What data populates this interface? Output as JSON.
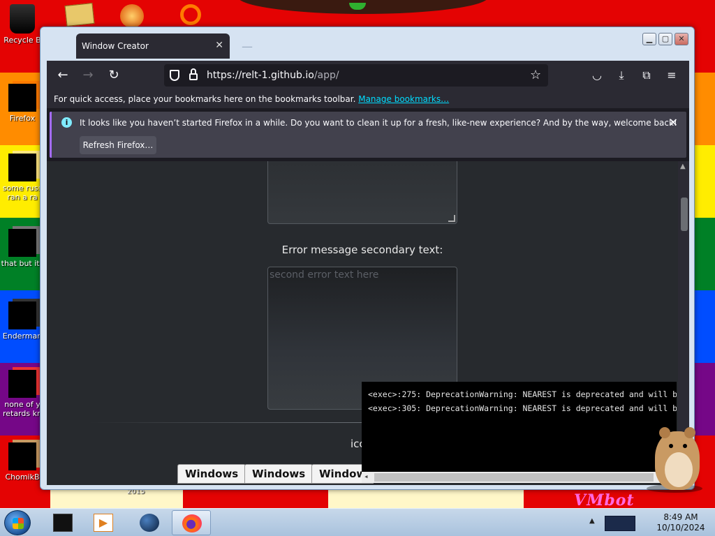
{
  "desktop": {
    "icons": [
      {
        "label": "Recycle B"
      },
      {
        "label": "Firefox"
      },
      {
        "label": "some russ ran a ra"
      },
      {
        "label": "that but its"
      },
      {
        "label": "Enderman"
      },
      {
        "label": "none of y retards kn"
      },
      {
        "label": "ChomikB"
      }
    ],
    "wallpaper_year": "2015",
    "vm_brand": "VMbot"
  },
  "window": {
    "tab_title": "Window Creator",
    "url_main": "https://relt-1.github.io",
    "url_path": "/app/"
  },
  "bookmarks_bar": {
    "text": "For quick access, place your bookmarks here on the bookmarks toolbar. ",
    "link": "Manage bookmarks…"
  },
  "notice": {
    "message": "It looks like you haven’t started Firefox in a while. Do you want to clean it up for a fresh, like-new experience? And by the way, welcome back!",
    "button": "Refresh Firefox…"
  },
  "page": {
    "secondary_label": "Error message secondary text:",
    "secondary_placeholder": "second error text here",
    "icon_label": "icc",
    "os_buttons": [
      "Windows",
      "Windows",
      "Window"
    ]
  },
  "console": {
    "lines": [
      "<exec>:275: DeprecationWarning: NEAREST is deprecated and will b",
      "<exec>:305: DeprecationWarning: NEAREST is deprecated and will b"
    ]
  },
  "taskbar": {
    "time": "8:49 AM",
    "date": "10/10/2024"
  },
  "colors": {
    "firefox_dark": "#1c1b22",
    "toolbar": "#2b2a33",
    "link": "#00ddff",
    "notice_bg": "#42414d",
    "notice_accent": "#a56cff"
  }
}
